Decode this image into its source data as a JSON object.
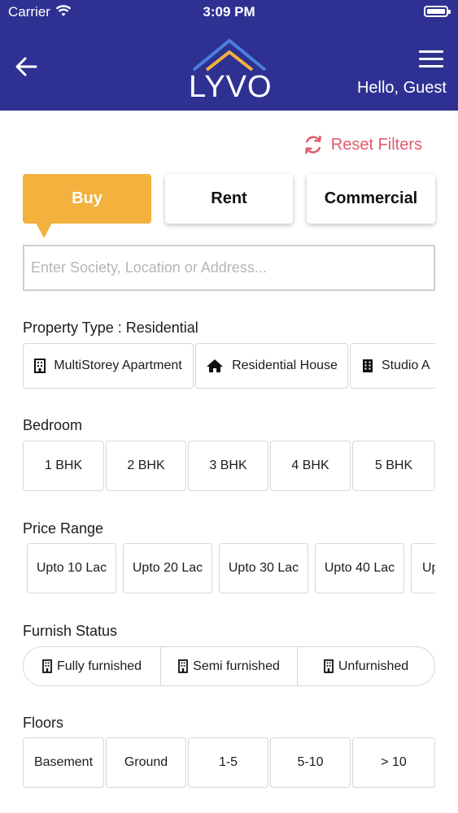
{
  "status_bar": {
    "carrier": "Carrier",
    "time": "3:09 PM"
  },
  "header": {
    "logo_text": "LYVO",
    "greeting": "Hello, Guest"
  },
  "reset_filters": {
    "label": "Reset Filters"
  },
  "deal_tabs": [
    {
      "label": "Buy",
      "active": true
    },
    {
      "label": "Rent",
      "active": false
    },
    {
      "label": "Commercial",
      "active": false
    }
  ],
  "search": {
    "placeholder": "Enter Society, Location or Address...",
    "value": ""
  },
  "property_type": {
    "title": "Property Type : Residential",
    "options": [
      {
        "label": "MultiStorey Apartment",
        "icon": "apartment-building-icon"
      },
      {
        "label": "Residential House",
        "icon": "house-icon"
      },
      {
        "label": "Studio A",
        "icon": "studio-building-icon"
      }
    ]
  },
  "bedroom": {
    "title": "Bedroom",
    "options": [
      "1 BHK",
      "2 BHK",
      "3 BHK",
      "4 BHK",
      "5 BHK"
    ]
  },
  "price_range": {
    "title": "Price Range",
    "options": [
      "Upto 10 Lac",
      "Upto 20 Lac",
      "Upto 30 Lac",
      "Upto 40 Lac",
      "Up"
    ]
  },
  "furnish_status": {
    "title": "Furnish Status",
    "options": [
      "Fully furnished",
      "Semi furnished",
      "Unfurnished"
    ]
  },
  "floors": {
    "title": "Floors",
    "options": [
      "Basement",
      "Ground",
      "1-5",
      "5-10",
      "> 10"
    ]
  },
  "colors": {
    "header_bg": "#2e3192",
    "accent": "#f3b13d",
    "reset": "#e05a6d"
  }
}
